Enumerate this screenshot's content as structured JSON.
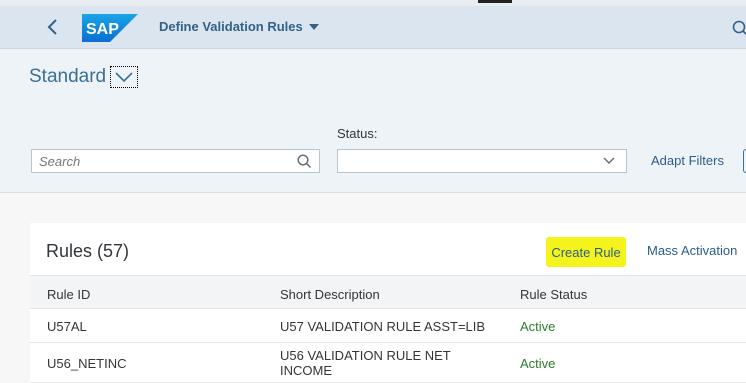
{
  "shell": {
    "app_title": "Define Validation Rules",
    "logo_text": "SAP"
  },
  "filterbar": {
    "variant_name": "Standard",
    "search_placeholder": "Search",
    "search_value": "",
    "status_label": "Status:",
    "status_value": "",
    "adapt_filters_label": "Adapt Filters"
  },
  "table": {
    "title": "Rules (57)",
    "create_rule_label": "Create Rule",
    "mass_activation_label": "Mass Activation",
    "columns": [
      "Rule ID",
      "Short Description",
      "Rule Status"
    ],
    "rows": [
      {
        "rule_id": "U57AL",
        "description": "U57 VALIDATION RULE ASST=LIB",
        "status": "Active"
      },
      {
        "rule_id": "U56_NETINC",
        "description": "U56 VALIDATION RULE NET INCOME",
        "status": "Active"
      }
    ]
  },
  "colors": {
    "shell_bg": "#dbe5ef",
    "filterbar_bg": "#eef3f8",
    "link": "#2b5d8a",
    "highlight": "#f4f41c",
    "active_status": "#2b7c2b"
  },
  "icons": [
    "back-arrow-icon",
    "sap-logo",
    "dropdown-caret-icon",
    "search-icon",
    "chevron-down-icon"
  ]
}
